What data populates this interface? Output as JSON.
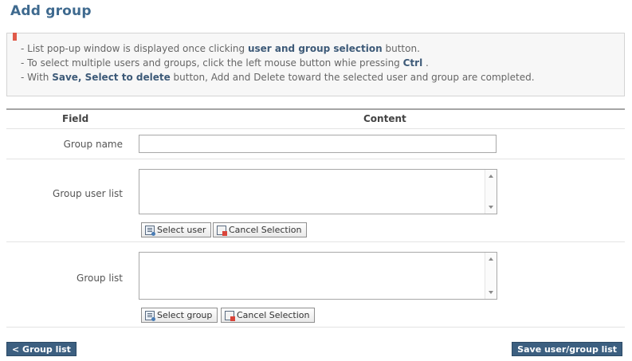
{
  "page": {
    "title": "Add group"
  },
  "info": {
    "line1": {
      "prefix": "- List pop-up window is displayed once clicking ",
      "emph": "user and group selection",
      "suffix": " button."
    },
    "line2": {
      "prefix": "- To select multiple users and groups, click the left mouse button whie pressing ",
      "emph": "Ctrl",
      "suffix": " ."
    },
    "line3": {
      "prefix": "- With ",
      "emph": "Save, Select to delete",
      "suffix": " button, Add and Delete toward the selected user and group are completed."
    }
  },
  "table": {
    "headers": {
      "field": "Field",
      "content": "Content"
    },
    "group_name": {
      "label": "Group name",
      "value": ""
    },
    "group_user_list": {
      "label": "Group user list",
      "select_label": "Select user",
      "cancel_label": "Cancel Selection"
    },
    "group_list": {
      "label": "Group list",
      "select_label": "Select group",
      "cancel_label": "Cancel Selection"
    }
  },
  "footer": {
    "back_label": "< Group list",
    "save_label": "Save user/group list"
  },
  "colors": {
    "accent": "#3c5f80",
    "title": "#3f6a8f",
    "emphasis": "#3d5a78"
  }
}
